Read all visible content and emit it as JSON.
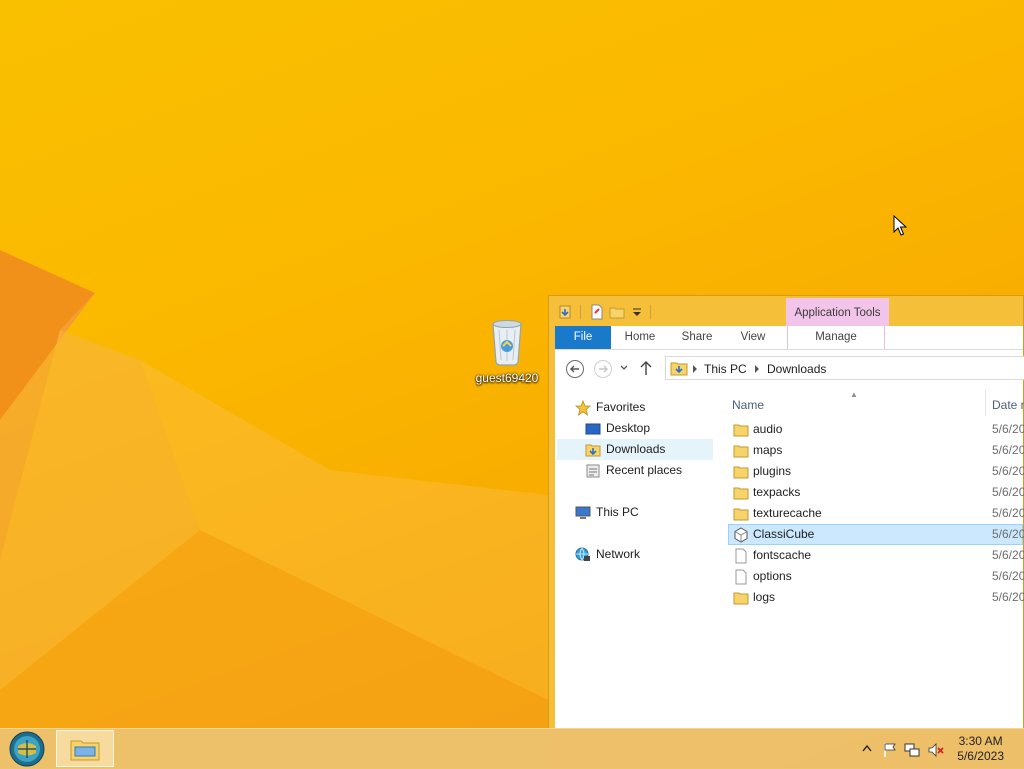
{
  "desktop": {
    "recycle_bin_label": "guest69420"
  },
  "explorer": {
    "contextual_tab_group": "Application Tools",
    "ribbon_tabs": {
      "file": "File",
      "home": "Home",
      "share": "Share",
      "view": "View",
      "manage": "Manage"
    },
    "breadcrumb": [
      "This PC",
      "Downloads"
    ],
    "nav_pane": {
      "favorites": "Favorites",
      "desktop": "Desktop",
      "downloads": "Downloads",
      "recent_places": "Recent places",
      "this_pc": "This PC",
      "network": "Network"
    },
    "columns": {
      "name": "Name",
      "date": "Date m"
    },
    "files": [
      {
        "name": "audio",
        "date": "5/6/20",
        "type": "folder"
      },
      {
        "name": "maps",
        "date": "5/6/20",
        "type": "folder"
      },
      {
        "name": "plugins",
        "date": "5/6/20",
        "type": "folder"
      },
      {
        "name": "texpacks",
        "date": "5/6/20",
        "type": "folder"
      },
      {
        "name": "texturecache",
        "date": "5/6/20",
        "type": "folder"
      },
      {
        "name": "ClassiCube",
        "date": "5/6/20",
        "type": "application",
        "selected": true
      },
      {
        "name": "fontscache",
        "date": "5/6/20",
        "type": "file"
      },
      {
        "name": "options",
        "date": "5/6/20",
        "type": "file"
      },
      {
        "name": "logs",
        "date": "5/6/20",
        "type": "folder"
      }
    ]
  },
  "taskbar": {
    "time": "3:30 AM",
    "date": "5/6/2023"
  },
  "colors": {
    "accent_file_tab": "#1979ca",
    "contextual_tab": "#f3c4e9",
    "selection": "#cce8ff",
    "window_frame": "#f5bf3a"
  }
}
